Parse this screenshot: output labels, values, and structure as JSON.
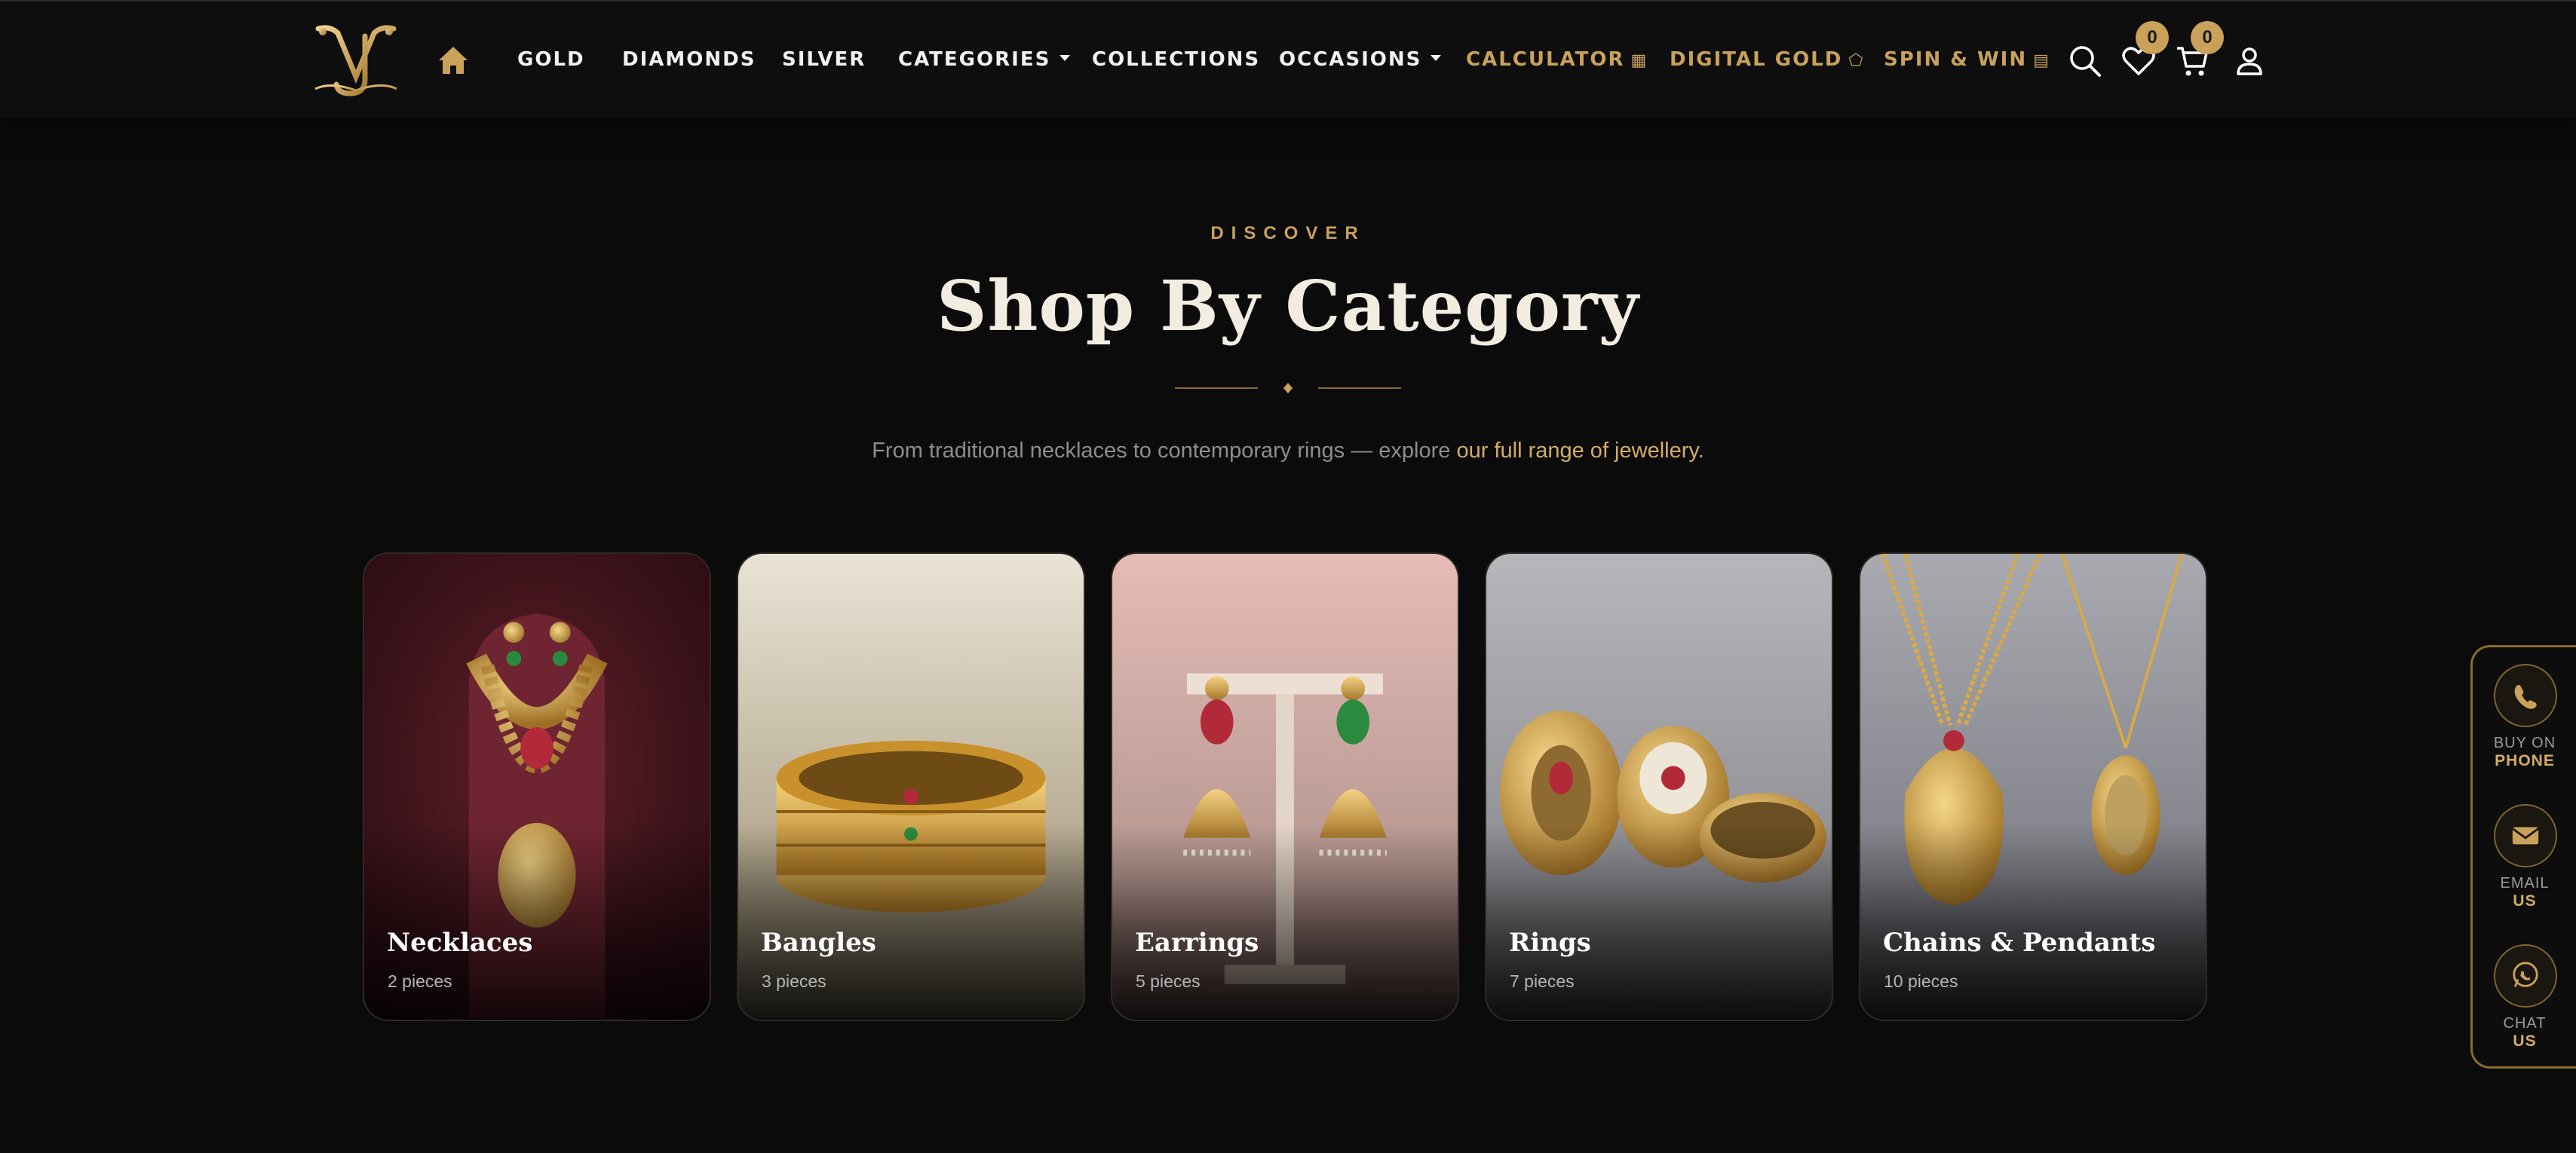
{
  "nav": {
    "links": [
      {
        "label": "GOLD"
      },
      {
        "label": "DIAMONDS"
      },
      {
        "label": "SILVER"
      },
      {
        "label": "CATEGORIES"
      },
      {
        "label": "COLLECTIONS"
      },
      {
        "label": "OCCASIONS"
      },
      {
        "label": "CALCULATOR"
      },
      {
        "label": "DIGITAL GOLD"
      },
      {
        "label": "SPIN & WIN"
      }
    ],
    "wishlist_count": "0",
    "cart_count": "0"
  },
  "header": {
    "eyebrow": "DISCOVER",
    "title": "Shop By Category",
    "subtitle_plain": "From traditional necklaces to contemporary rings — explore ",
    "subtitle_highlight": "our full range of jewellery."
  },
  "categories": [
    {
      "name": "Necklaces",
      "count": "2 pieces"
    },
    {
      "name": "Bangles",
      "count": "3 pieces"
    },
    {
      "name": "Earrings",
      "count": "5 pieces"
    },
    {
      "name": "Rings",
      "count": "7 pieces"
    },
    {
      "name": "Chains & Pendants",
      "count": "10 pieces"
    }
  ],
  "contact": {
    "phone": {
      "top": "BUY ON",
      "bottom": "PHONE"
    },
    "email": {
      "top": "EMAIL",
      "bottom": "US"
    },
    "chat": {
      "top": "CHAT",
      "bottom": "US"
    }
  },
  "colors": {
    "background": "#0b0b0b",
    "accent_gold": "#c9a15a",
    "title": "#f3ece0"
  }
}
